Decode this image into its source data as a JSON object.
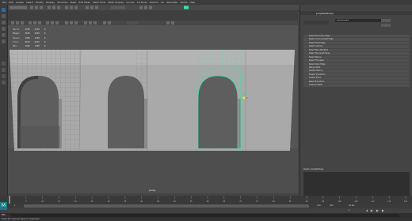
{
  "colors": {
    "accent_green": "#2ee8a8",
    "selection_teal": "#1a7a88",
    "maya_blue": "#2a6aa8"
  },
  "hud": {
    "rows": [
      {
        "label": "Verts:",
        "a": "1330",
        "b": "1330",
        "c": "0"
      },
      {
        "label": "Edges:",
        "a": "2638",
        "b": "2638",
        "c": "0"
      },
      {
        "label": "Faces:",
        "a": "1308",
        "b": "1308",
        "c": "0"
      },
      {
        "label": "Tris:",
        "a": "2616",
        "b": "2616",
        "c": "0"
      },
      {
        "label": "UVs:",
        "a": "1480",
        "b": "1480",
        "c": "0"
      }
    ]
  },
  "viewport": {
    "camera_label": "persp",
    "icons": [
      "select-icon",
      "lasso-icon",
      "move-icon",
      "rotate-icon",
      "scale-icon"
    ]
  },
  "right_panel": {
    "tab_label": "polyWallShape",
    "input_value": "polyWallShape",
    "items": [
      "Select Boundary Edge",
      "Select Unconnected Edge",
      "Select Hard Edge",
      "Select Lamina",
      "Select Non Manifold",
      "Select Nonquad Faces",
      "Select Ngons",
      "Select Triangles",
      "Select Zero Edge",
      "Merge Verts",
      "Delete History",
      "Freeze Transform",
      "Center Pivot",
      "Reset Transform",
      "Cleanup Mesh"
    ],
    "footer_label": "Result: polyWallShape",
    "buttons": [
      "Select",
      "Load Attributes",
      "Copy Tab"
    ]
  },
  "timeline": {
    "ticks": [
      "1",
      "5",
      "10",
      "15",
      "20",
      "25",
      "30",
      "35",
      "40",
      "45",
      "50",
      "55",
      "60",
      "65",
      "70",
      "75",
      "80",
      "85",
      "90",
      "95",
      "100",
      "105",
      "110",
      "115",
      "120"
    ],
    "current_frame": "1"
  },
  "range": {
    "start": "1",
    "inner_start": "1",
    "inner_end": "120",
    "end": "200",
    "fps": "24 fps"
  },
  "command_line": {
    "mode": "MEL",
    "help_text": "Select Tool: select an object or components"
  }
}
